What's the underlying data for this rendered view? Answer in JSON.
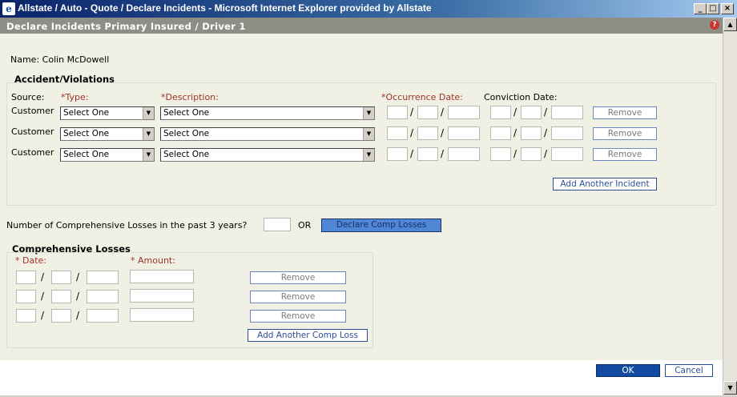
{
  "window": {
    "title": "Allstate / Auto - Quote / Declare Incidents - Microsoft Internet Explorer provided by Allstate",
    "ie_glyph": "e",
    "min_glyph": "_",
    "max_glyph": "□",
    "close_glyph": "×"
  },
  "dialog": {
    "title": "Declare Incidents Primary Insured / Driver 1",
    "help_glyph": "?"
  },
  "name_line": "Name: Colin McDowell",
  "accidents": {
    "section_title": "Accident/Violations",
    "headers": {
      "source": "Source:",
      "type": "*Type:",
      "description": "*Description:",
      "occurrence": "*Occurrence Date:",
      "conviction": "Conviction Date:"
    },
    "rows": [
      {
        "source": "Customer",
        "type": "Select One",
        "description": "Select One",
        "remove": "Remove"
      },
      {
        "source": "Customer",
        "type": "Select One",
        "description": "Select One",
        "remove": "Remove"
      },
      {
        "source": "Customer",
        "type": "Select One",
        "description": "Select One",
        "remove": "Remove"
      }
    ],
    "add_button": "Add Another Incident"
  },
  "comp_question": {
    "label": "Number of Comprehensive Losses in the past 3 years?",
    "value": "",
    "or_text": "OR",
    "declare_button": "Declare Comp Losses"
  },
  "comp_losses": {
    "section_title": "Comprehensive Losses",
    "date_header": "* Date:",
    "amount_header": "* Amount:",
    "rows": [
      {
        "remove": "Remove"
      },
      {
        "remove": "Remove"
      },
      {
        "remove": "Remove"
      }
    ],
    "add_button": "Add Another Comp Loss"
  },
  "footer": {
    "ok": "OK",
    "cancel": "Cancel"
  },
  "colors": {
    "title_bar": "#0a246a",
    "dialog_header": "#8e8e86",
    "content_bg": "#f0f0e4",
    "required_label": "#a0322a",
    "button_border": "#2c4e96",
    "ok_button": "#124aa0"
  }
}
